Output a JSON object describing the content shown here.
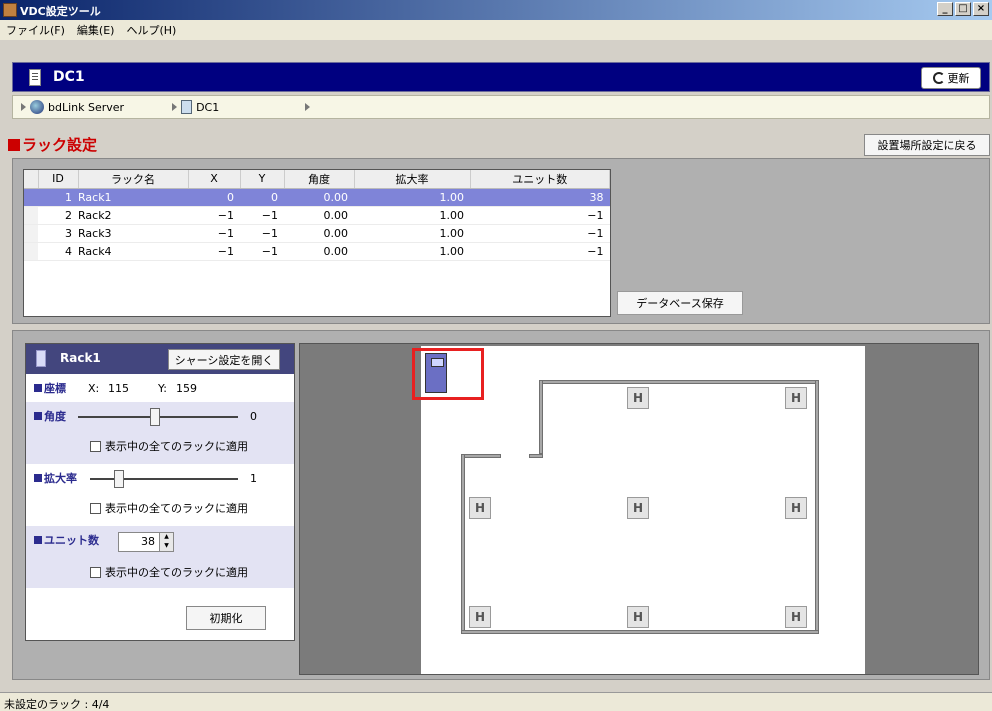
{
  "window": {
    "title": "VDC設定ツール",
    "buttons": [
      "_",
      "□",
      "×"
    ]
  },
  "menu": [
    "ファイル(F)",
    "編集(E)",
    "ヘルプ(H)"
  ],
  "header": {
    "title": "DC1",
    "refresh_label": "更新"
  },
  "breadcrumb": [
    "bdLink Server",
    "DC1"
  ],
  "section": {
    "title": "ラック設定",
    "back_label": "設置場所設定に戻る"
  },
  "rack_table": {
    "columns": [
      "ID",
      "ラック名",
      "X",
      "Y",
      "角度",
      "拡大率",
      "ユニット数"
    ],
    "rows": [
      {
        "id": "1",
        "name": "Rack1",
        "x": "0",
        "y": "0",
        "angle": "0.00",
        "scale": "1.00",
        "units": "38"
      },
      {
        "id": "2",
        "name": "Rack2",
        "x": "−1",
        "y": "−1",
        "angle": "0.00",
        "scale": "1.00",
        "units": "−1"
      },
      {
        "id": "3",
        "name": "Rack3",
        "x": "−1",
        "y": "−1",
        "angle": "0.00",
        "scale": "1.00",
        "units": "−1"
      },
      {
        "id": "4",
        "name": "Rack4",
        "x": "−1",
        "y": "−1",
        "angle": "0.00",
        "scale": "1.00",
        "units": "−1"
      }
    ],
    "selected_row": 0,
    "save_label": "データベース保存"
  },
  "props": {
    "rack_name": "Rack1",
    "chassis_label": "シャーシ設定を開く",
    "coord_label": "座標",
    "x_label": "X:",
    "x_value": "115",
    "y_label": "Y:",
    "y_value": "159",
    "angle_label": "角度",
    "angle_value": "0",
    "scale_label": "拡大率",
    "scale_value": "1",
    "units_label": "ユニット数",
    "units_value": "38",
    "apply_all_label": "表示中の全てのラックに適用",
    "reset_label": "初期化"
  },
  "floor": {
    "h_label": "H"
  },
  "status": {
    "text": "未設定のラック : 4/4"
  },
  "colors": {
    "accent": "#000080",
    "selection": "#7f84d8",
    "section_red": "#cc0000",
    "highlight": "#e82020"
  }
}
